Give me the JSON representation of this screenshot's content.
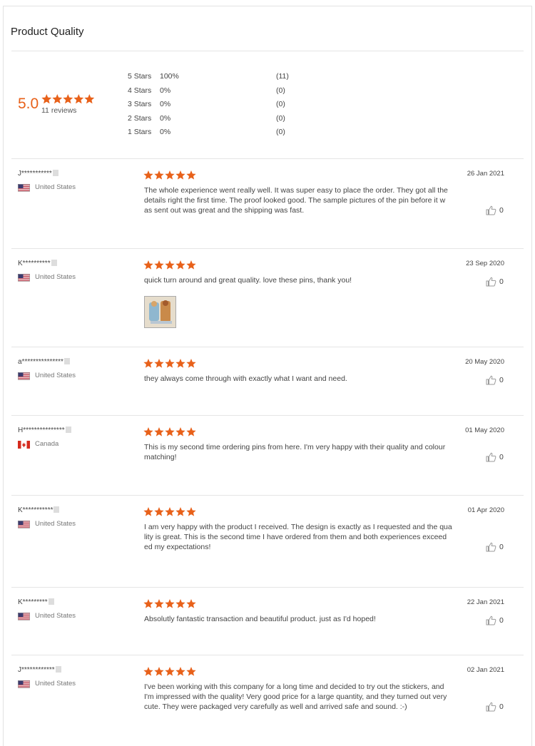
{
  "section": {
    "title": "Product Quality",
    "rating": "5.0",
    "stars": 5,
    "review_count": "11 reviews",
    "accent_color": "#e8611a",
    "distribution": [
      {
        "label": "5 Stars",
        "pct": "100%",
        "count": "(11)"
      },
      {
        "label": "4 Stars",
        "pct": "0%",
        "count": "(0)"
      },
      {
        "label": "3 Stars",
        "pct": "0%",
        "count": "(0)"
      },
      {
        "label": "2 Stars",
        "pct": "0%",
        "count": "(0)"
      },
      {
        "label": "1 Stars",
        "pct": "0%",
        "count": "(0)"
      }
    ]
  },
  "reviews": [
    {
      "name": "J***********",
      "country": "United States",
      "flag": "us-flag-icon",
      "stars": 5,
      "date": "26 Jan 2021",
      "likes": "0",
      "lines": [
        "The whole experience went really well. It was super easy to place the order. They got all the",
        "details right the first time. The proof looked good. The sample pictures of the pin before it w",
        "as sent out was great and the shipping was fast."
      ]
    },
    {
      "name": "K**********",
      "country": "United States",
      "flag": "us-flag-icon",
      "stars": 5,
      "date": "23 Sep 2020",
      "likes": "0",
      "lines": [
        "quick turn around and great quality. love these pins, thank you!"
      ],
      "has_image": true
    },
    {
      "name": "a***************",
      "country": "United States",
      "flag": "us-flag-icon",
      "stars": 5,
      "date": "20 May 2020",
      "likes": "0",
      "lines": [
        "they always come through with exactly what I want and need."
      ]
    },
    {
      "name": "H***************",
      "country": "Canada",
      "flag": "canada-flag-icon",
      "stars": 5,
      "date": "01 May 2020",
      "likes": "0",
      "lines": [
        "This is my second time ordering pins from here. I'm very happy with their quality and colour",
        "matching!"
      ]
    },
    {
      "name": "K***********",
      "country": "United States",
      "flag": "us-flag-icon",
      "stars": 5,
      "date": "01 Apr 2020",
      "likes": "0",
      "lines": [
        "I am very happy with the product I received. The design is exactly as I requested and the qua",
        "lity is great. This is the second time I have ordered from them and both experiences exceed",
        "ed my expectations!"
      ]
    },
    {
      "name": "K*********",
      "country": "United States",
      "flag": "us-flag-icon",
      "stars": 5,
      "date": "22 Jan 2021",
      "likes": "0",
      "lines": [
        "Absolutly fantastic transaction and beautiful product. just as I'd hoped!"
      ]
    },
    {
      "name": "J************",
      "country": "United States",
      "flag": "us-flag-icon",
      "stars": 5,
      "date": "02 Jan 2021",
      "likes": "0",
      "lines": [
        "I've been working with this company for a long time and decided to try out the stickers, and",
        "I'm impressed with the quality! Very good price for a large quantity, and they turned out very",
        "cute. They were packaged very carefully as well and arrived safe and sound. :-)"
      ]
    }
  ]
}
